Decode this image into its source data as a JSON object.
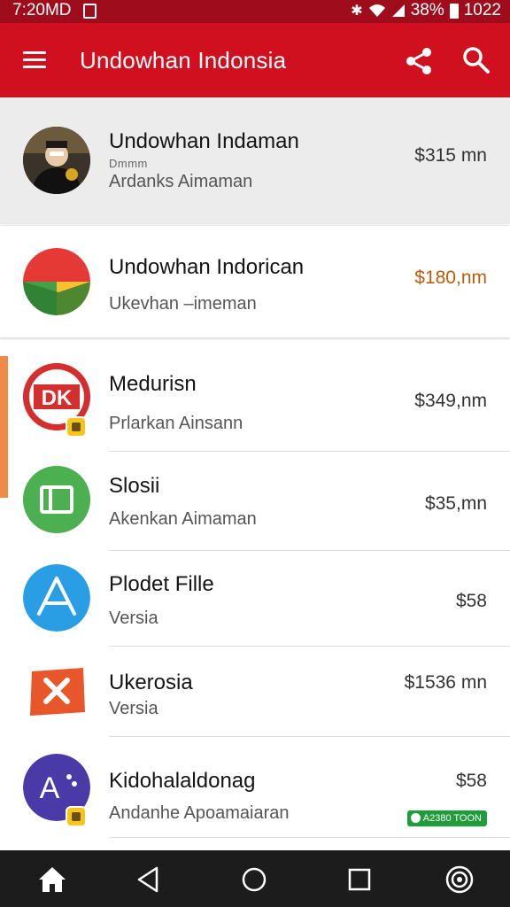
{
  "status_bar": {
    "time": "7:20MD",
    "battery": "38%",
    "clock_right": "1022",
    "icons": [
      "notification-icon",
      "bluetooth-icon",
      "wifi-icon",
      "signal-icon",
      "battery-icon"
    ]
  },
  "app_bar": {
    "title": "Undowhan Indonsia",
    "background": "#d0101f",
    "icons": [
      "menu-icon",
      "share-icon",
      "search-icon"
    ]
  },
  "list": [
    {
      "name": "Undowhan Indaman",
      "sub_small": "Dmmm",
      "sub": "Ardanks Aimaman",
      "price": "$315 mn",
      "price_color": "#333333",
      "avatar": "person-portrait-avatar"
    },
    {
      "name": "Undowhan Indorican",
      "sub": "Ukevhan –imeman",
      "price": "$180,nm",
      "price_color": "#c05a0a",
      "avatar": "chrome-like-logo"
    },
    {
      "name": "Medurisn",
      "sub": "Prlarkan Ainsann",
      "price": "$349,nm",
      "price_color": "#333333",
      "avatar": "red-dk-logo",
      "badge": "app-badge-icon"
    },
    {
      "name": "Slosii",
      "sub": "Akenkan Aimaman",
      "price": "$35,mn",
      "price_color": "#333333",
      "avatar": "green-book-logo"
    },
    {
      "name": "Plodet Fille",
      "sub": "Versia",
      "price": "$58",
      "price_color": "#333333",
      "avatar": "blue-a-logo"
    },
    {
      "name": "Ukerosia",
      "sub": "Versia",
      "price": "$1536 mn",
      "price_color": "#333333",
      "avatar": "orange-x-logo"
    },
    {
      "name": "Kidohalaldonag",
      "sub": "Andanhe Apoamaiaran",
      "price": "$58",
      "price_color": "#333333",
      "avatar": "purple-a-logo",
      "badge": "app-badge-icon",
      "tag": "A2380 TOON"
    }
  ],
  "nav_bar": {
    "icons": [
      "home-icon",
      "back-icon",
      "circle-home-icon",
      "recents-icon",
      "target-icon"
    ]
  },
  "colors": {
    "status_bar": "#9f0d1c",
    "app_bar": "#d0101f",
    "accent": "#f08a4b",
    "sale_tag": "#1f9d3a"
  }
}
